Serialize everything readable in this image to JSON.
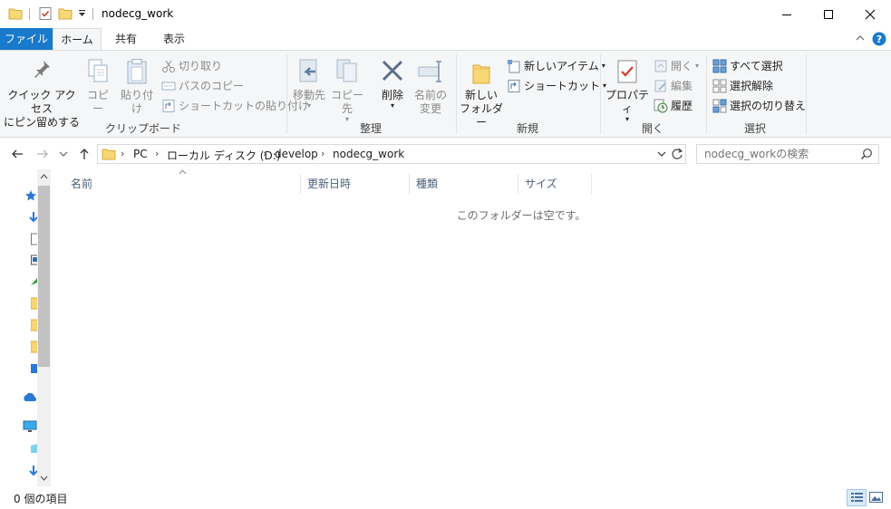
{
  "window": {
    "title": "nodecg_work",
    "minimize_icon": "minimize-icon",
    "maximize_icon": "maximize-icon",
    "close_icon": "close-icon"
  },
  "tabs": {
    "file": "ファイル",
    "home": "ホーム",
    "share": "共有",
    "view": "表示"
  },
  "ribbon": {
    "clipboard": {
      "label": "クリップボード",
      "pin_line1": "クイック アクセス",
      "pin_line2": "にピン留めする",
      "copy": "コピー",
      "paste": "貼り付け",
      "cut": "切り取り",
      "copy_path": "パスのコピー",
      "paste_shortcut": "ショートカットの貼り付け"
    },
    "organize": {
      "label": "整理",
      "move_to": "移動先",
      "copy_to": "コピー先",
      "delete": "削除",
      "rename_line1": "名前の",
      "rename_line2": "変更"
    },
    "new": {
      "label": "新規",
      "new_folder_line1": "新しい",
      "new_folder_line2": "フォルダー",
      "new_item": "新しいアイテム",
      "easy_access": "ショートカット"
    },
    "open": {
      "label": "開く",
      "properties": "プロパティ",
      "open": "開く",
      "edit": "編集",
      "history": "履歴"
    },
    "select": {
      "label": "選択",
      "select_all": "すべて選択",
      "select_none": "選択解除",
      "invert": "選択の切り替え"
    }
  },
  "address": {
    "crumbs": [
      "PC",
      "ローカル ディスク (D:)",
      "develop",
      "nodecg_work"
    ],
    "search_placeholder": "nodecg_workの検索"
  },
  "columns": [
    "名前",
    "更新日時",
    "種類",
    "サイズ"
  ],
  "empty_message": "このフォルダーは空です。",
  "status": {
    "item_count": "0 個の項目"
  },
  "colors": {
    "accent": "#1979ca",
    "folder": "#f8d775",
    "ribbon_bg": "#f5f6f7"
  }
}
